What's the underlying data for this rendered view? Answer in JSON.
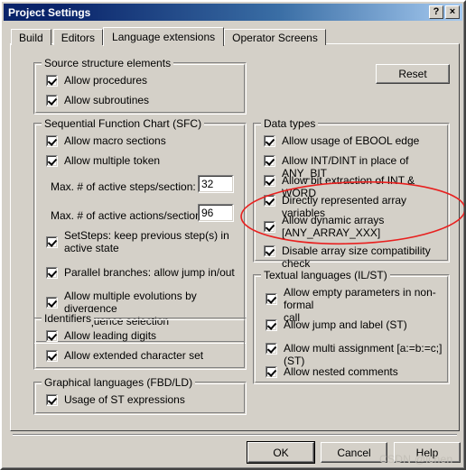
{
  "window": {
    "title": "Project Settings",
    "help_button": "?",
    "close_button": "×"
  },
  "tabs": [
    {
      "label": "Build",
      "active": false
    },
    {
      "label": "Editors",
      "active": false
    },
    {
      "label": "Language extensions",
      "active": true
    },
    {
      "label": "Operator Screens",
      "active": false
    }
  ],
  "reset_button": {
    "label": "Reset"
  },
  "groups": {
    "source_structure": {
      "title": "Source structure elements",
      "items": [
        {
          "label": "Allow procedures",
          "checked": true
        },
        {
          "label": "Allow subroutines",
          "checked": true
        }
      ]
    },
    "sfc": {
      "title": "Sequential Function Chart (SFC)",
      "items": [
        {
          "label": "Allow macro sections",
          "checked": true
        },
        {
          "label": "Allow multiple token",
          "checked": true
        }
      ],
      "fields": [
        {
          "label": "Max. # of active steps/section:",
          "value": "32"
        },
        {
          "label": "Max. # of active actions/section:",
          "value": "96"
        }
      ],
      "items2": [
        {
          "label": "SetSteps: keep previous step(s) in\nactive state",
          "checked": true
        },
        {
          "label": "Parallel branches: allow jump in/out",
          "checked": true
        },
        {
          "label": "Allow multiple evolutions by divergence\nof sequence selection",
          "checked": true
        }
      ]
    },
    "identifiers": {
      "title": "Identifiers",
      "items": [
        {
          "label": "Allow leading digits",
          "checked": true
        },
        {
          "label": "Allow extended character set",
          "checked": true
        }
      ]
    },
    "graphical": {
      "title": "Graphical languages (FBD/LD)",
      "items": [
        {
          "label": "Usage of ST expressions",
          "checked": true
        }
      ]
    },
    "data_types": {
      "title": "Data types",
      "items": [
        {
          "label": "Allow usage of EBOOL edge",
          "checked": true
        },
        {
          "label": "Allow INT/DINT in place of ANY_BIT",
          "checked": true
        },
        {
          "label": "Allow bit extraction of INT & WORD",
          "checked": true
        },
        {
          "label": "Directly represented array variables",
          "checked": true
        },
        {
          "label": "Allow dynamic arrays\n[ANY_ARRAY_XXX]",
          "checked": true
        },
        {
          "label": "Disable array size compatibility check",
          "checked": true
        }
      ]
    },
    "textual": {
      "title": "Textual languages (IL/ST)",
      "items": [
        {
          "label": "Allow empty parameters in non-formal\ncall",
          "checked": true
        },
        {
          "label": "Allow jump and label (ST)",
          "checked": true
        },
        {
          "label": "Allow multi assignment [a:=b:=c;] (ST)",
          "checked": true
        },
        {
          "label": "Allow nested comments",
          "checked": true
        }
      ]
    }
  },
  "footer_buttons": [
    {
      "label": "OK",
      "default": true
    },
    {
      "label": "Cancel",
      "default": false
    },
    {
      "label": "Help",
      "default": false
    }
  ],
  "annotation": {
    "shape": "ellipse",
    "color": "#e8201f"
  },
  "watermark": "CSDN @lchen"
}
